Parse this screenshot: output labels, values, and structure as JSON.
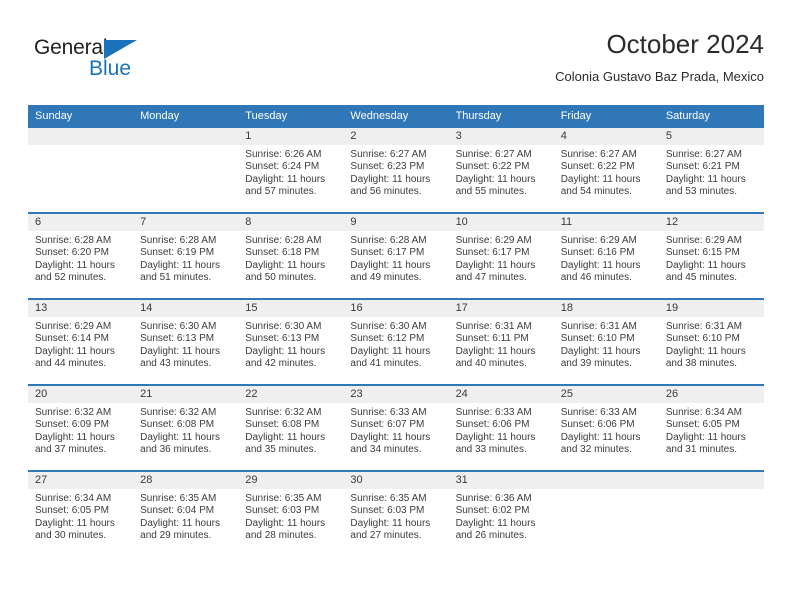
{
  "logo": {
    "word_top": "General",
    "word_bottom": "Blue",
    "triangle_color": "#1a72ba",
    "text_color": "#231f20",
    "blue_color": "#1a72ba"
  },
  "header": {
    "title": "October 2024",
    "subtitle": "Colonia Gustavo Baz Prada, Mexico"
  },
  "theme": {
    "header_blue": "#3077b8",
    "band_gray": "#efefef",
    "text": "#3c3c3c"
  },
  "weekday_headers": [
    "Sunday",
    "Monday",
    "Tuesday",
    "Wednesday",
    "Thursday",
    "Friday",
    "Saturday"
  ],
  "weeks": [
    [
      {
        "day": "",
        "sunrise": "",
        "sunset": "",
        "daylight_line1": "",
        "daylight_line2": ""
      },
      {
        "day": "",
        "sunrise": "",
        "sunset": "",
        "daylight_line1": "",
        "daylight_line2": ""
      },
      {
        "day": "1",
        "sunrise": "Sunrise: 6:26 AM",
        "sunset": "Sunset: 6:24 PM",
        "daylight_line1": "Daylight: 11 hours",
        "daylight_line2": "and 57 minutes."
      },
      {
        "day": "2",
        "sunrise": "Sunrise: 6:27 AM",
        "sunset": "Sunset: 6:23 PM",
        "daylight_line1": "Daylight: 11 hours",
        "daylight_line2": "and 56 minutes."
      },
      {
        "day": "3",
        "sunrise": "Sunrise: 6:27 AM",
        "sunset": "Sunset: 6:22 PM",
        "daylight_line1": "Daylight: 11 hours",
        "daylight_line2": "and 55 minutes."
      },
      {
        "day": "4",
        "sunrise": "Sunrise: 6:27 AM",
        "sunset": "Sunset: 6:22 PM",
        "daylight_line1": "Daylight: 11 hours",
        "daylight_line2": "and 54 minutes."
      },
      {
        "day": "5",
        "sunrise": "Sunrise: 6:27 AM",
        "sunset": "Sunset: 6:21 PM",
        "daylight_line1": "Daylight: 11 hours",
        "daylight_line2": "and 53 minutes."
      }
    ],
    [
      {
        "day": "6",
        "sunrise": "Sunrise: 6:28 AM",
        "sunset": "Sunset: 6:20 PM",
        "daylight_line1": "Daylight: 11 hours",
        "daylight_line2": "and 52 minutes."
      },
      {
        "day": "7",
        "sunrise": "Sunrise: 6:28 AM",
        "sunset": "Sunset: 6:19 PM",
        "daylight_line1": "Daylight: 11 hours",
        "daylight_line2": "and 51 minutes."
      },
      {
        "day": "8",
        "sunrise": "Sunrise: 6:28 AM",
        "sunset": "Sunset: 6:18 PM",
        "daylight_line1": "Daylight: 11 hours",
        "daylight_line2": "and 50 minutes."
      },
      {
        "day": "9",
        "sunrise": "Sunrise: 6:28 AM",
        "sunset": "Sunset: 6:17 PM",
        "daylight_line1": "Daylight: 11 hours",
        "daylight_line2": "and 49 minutes."
      },
      {
        "day": "10",
        "sunrise": "Sunrise: 6:29 AM",
        "sunset": "Sunset: 6:17 PM",
        "daylight_line1": "Daylight: 11 hours",
        "daylight_line2": "and 47 minutes."
      },
      {
        "day": "11",
        "sunrise": "Sunrise: 6:29 AM",
        "sunset": "Sunset: 6:16 PM",
        "daylight_line1": "Daylight: 11 hours",
        "daylight_line2": "and 46 minutes."
      },
      {
        "day": "12",
        "sunrise": "Sunrise: 6:29 AM",
        "sunset": "Sunset: 6:15 PM",
        "daylight_line1": "Daylight: 11 hours",
        "daylight_line2": "and 45 minutes."
      }
    ],
    [
      {
        "day": "13",
        "sunrise": "Sunrise: 6:29 AM",
        "sunset": "Sunset: 6:14 PM",
        "daylight_line1": "Daylight: 11 hours",
        "daylight_line2": "and 44 minutes."
      },
      {
        "day": "14",
        "sunrise": "Sunrise: 6:30 AM",
        "sunset": "Sunset: 6:13 PM",
        "daylight_line1": "Daylight: 11 hours",
        "daylight_line2": "and 43 minutes."
      },
      {
        "day": "15",
        "sunrise": "Sunrise: 6:30 AM",
        "sunset": "Sunset: 6:13 PM",
        "daylight_line1": "Daylight: 11 hours",
        "daylight_line2": "and 42 minutes."
      },
      {
        "day": "16",
        "sunrise": "Sunrise: 6:30 AM",
        "sunset": "Sunset: 6:12 PM",
        "daylight_line1": "Daylight: 11 hours",
        "daylight_line2": "and 41 minutes."
      },
      {
        "day": "17",
        "sunrise": "Sunrise: 6:31 AM",
        "sunset": "Sunset: 6:11 PM",
        "daylight_line1": "Daylight: 11 hours",
        "daylight_line2": "and 40 minutes."
      },
      {
        "day": "18",
        "sunrise": "Sunrise: 6:31 AM",
        "sunset": "Sunset: 6:10 PM",
        "daylight_line1": "Daylight: 11 hours",
        "daylight_line2": "and 39 minutes."
      },
      {
        "day": "19",
        "sunrise": "Sunrise: 6:31 AM",
        "sunset": "Sunset: 6:10 PM",
        "daylight_line1": "Daylight: 11 hours",
        "daylight_line2": "and 38 minutes."
      }
    ],
    [
      {
        "day": "20",
        "sunrise": "Sunrise: 6:32 AM",
        "sunset": "Sunset: 6:09 PM",
        "daylight_line1": "Daylight: 11 hours",
        "daylight_line2": "and 37 minutes."
      },
      {
        "day": "21",
        "sunrise": "Sunrise: 6:32 AM",
        "sunset": "Sunset: 6:08 PM",
        "daylight_line1": "Daylight: 11 hours",
        "daylight_line2": "and 36 minutes."
      },
      {
        "day": "22",
        "sunrise": "Sunrise: 6:32 AM",
        "sunset": "Sunset: 6:08 PM",
        "daylight_line1": "Daylight: 11 hours",
        "daylight_line2": "and 35 minutes."
      },
      {
        "day": "23",
        "sunrise": "Sunrise: 6:33 AM",
        "sunset": "Sunset: 6:07 PM",
        "daylight_line1": "Daylight: 11 hours",
        "daylight_line2": "and 34 minutes."
      },
      {
        "day": "24",
        "sunrise": "Sunrise: 6:33 AM",
        "sunset": "Sunset: 6:06 PM",
        "daylight_line1": "Daylight: 11 hours",
        "daylight_line2": "and 33 minutes."
      },
      {
        "day": "25",
        "sunrise": "Sunrise: 6:33 AM",
        "sunset": "Sunset: 6:06 PM",
        "daylight_line1": "Daylight: 11 hours",
        "daylight_line2": "and 32 minutes."
      },
      {
        "day": "26",
        "sunrise": "Sunrise: 6:34 AM",
        "sunset": "Sunset: 6:05 PM",
        "daylight_line1": "Daylight: 11 hours",
        "daylight_line2": "and 31 minutes."
      }
    ],
    [
      {
        "day": "27",
        "sunrise": "Sunrise: 6:34 AM",
        "sunset": "Sunset: 6:05 PM",
        "daylight_line1": "Daylight: 11 hours",
        "daylight_line2": "and 30 minutes."
      },
      {
        "day": "28",
        "sunrise": "Sunrise: 6:35 AM",
        "sunset": "Sunset: 6:04 PM",
        "daylight_line1": "Daylight: 11 hours",
        "daylight_line2": "and 29 minutes."
      },
      {
        "day": "29",
        "sunrise": "Sunrise: 6:35 AM",
        "sunset": "Sunset: 6:03 PM",
        "daylight_line1": "Daylight: 11 hours",
        "daylight_line2": "and 28 minutes."
      },
      {
        "day": "30",
        "sunrise": "Sunrise: 6:35 AM",
        "sunset": "Sunset: 6:03 PM",
        "daylight_line1": "Daylight: 11 hours",
        "daylight_line2": "and 27 minutes."
      },
      {
        "day": "31",
        "sunrise": "Sunrise: 6:36 AM",
        "sunset": "Sunset: 6:02 PM",
        "daylight_line1": "Daylight: 11 hours",
        "daylight_line2": "and 26 minutes."
      },
      {
        "day": "",
        "sunrise": "",
        "sunset": "",
        "daylight_line1": "",
        "daylight_line2": ""
      },
      {
        "day": "",
        "sunrise": "",
        "sunset": "",
        "daylight_line1": "",
        "daylight_line2": ""
      }
    ]
  ]
}
